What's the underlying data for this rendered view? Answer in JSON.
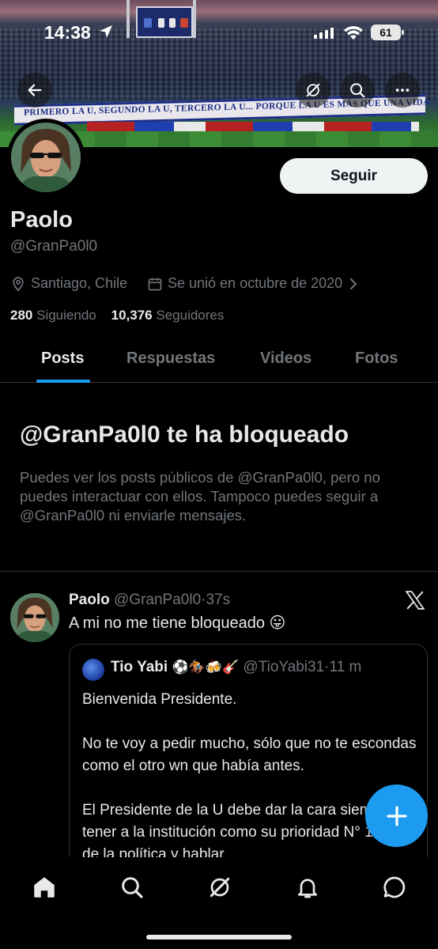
{
  "status_bar": {
    "time": "14:38",
    "battery": "61"
  },
  "banner": {
    "text": "PRIMERO LA U, SEGUNDO LA U, TERCERO LA U... PORQUE LA U ES MÁS QUE UNA VIDA"
  },
  "profile": {
    "name": "Paolo",
    "handle": "@GranPa0l0",
    "follow_label": "Seguir",
    "location": "Santiago, Chile",
    "joined": "Se unió en octubre de 2020",
    "following_count": "280",
    "following_label": "Siguiendo",
    "followers_count": "10,376",
    "followers_label": "Seguidores"
  },
  "tabs": [
    {
      "label": "Posts",
      "active": true
    },
    {
      "label": "Respuestas",
      "active": false
    },
    {
      "label": "Videos",
      "active": false
    },
    {
      "label": "Fotos",
      "active": false
    }
  ],
  "blocked": {
    "title": "@GranPa0l0 te ha bloqueado",
    "text": "Puedes ver los posts públicos de @GranPa0l0, pero no puedes interactuar con ellos. Tampoco puedes seguir a @GranPa0l0 ni enviarle mensajes."
  },
  "post": {
    "author": "Paolo",
    "handle": "@GranPa0l0",
    "time": "37s",
    "text": "A mi no me tiene bloqueado 😛",
    "quote": {
      "author": "Tio Yabi",
      "emojis": "⚽🏇🍻🎸",
      "handle": "@TioYabi31",
      "time": "11 m",
      "paragraphs": [
        "Bienvenida Presidente.",
        "No te voy a pedir mucho, sólo que no te escondas como el otro wn que había antes.",
        "El Presidente de la U debe dar la cara siempre y tener a la institución como su prioridad N° 1. Basta de la política y hablar"
      ]
    }
  },
  "colors": {
    "accent": "#1d9bf0",
    "background": "#000000",
    "muted": "#71767b",
    "text": "#e7e9ea"
  },
  "icons": {
    "back": "arrow-left-icon",
    "grok": "grok-icon",
    "search": "search-icon",
    "more": "more-icon",
    "location": "location-pin-icon",
    "calendar": "calendar-icon",
    "chevron": "chevron-right-icon",
    "x_logo": "x-logo-icon",
    "compose": "plus-icon",
    "nav": [
      "home-icon",
      "search-icon",
      "grok-icon",
      "bell-icon",
      "messages-icon"
    ]
  }
}
